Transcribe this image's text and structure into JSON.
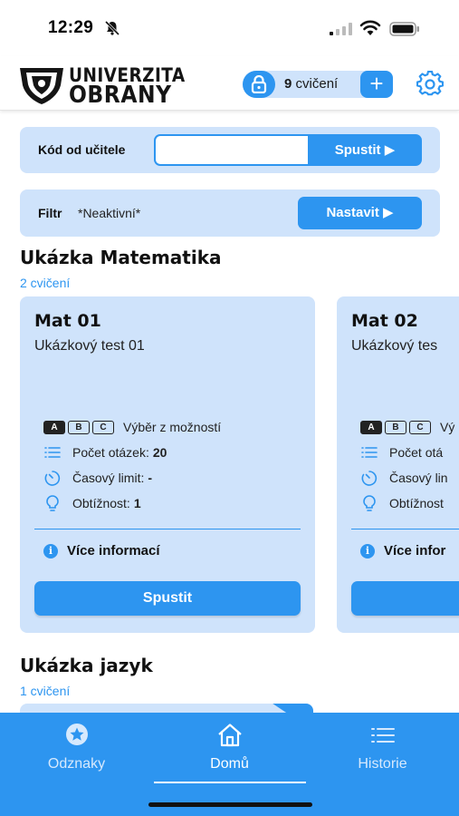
{
  "status_bar": {
    "time": "12:29"
  },
  "header": {
    "logo": {
      "line1": "UNIVERZITA",
      "line2": "OBRANY"
    },
    "credits": {
      "count": "9",
      "unit": "cvičení"
    },
    "add_label": "+"
  },
  "code_panel": {
    "label": "Kód od učitele",
    "input_value": "",
    "input_placeholder": "",
    "submit_label": "Spustit ▶"
  },
  "filter_panel": {
    "label": "Filtr",
    "value": "*Neaktivní*",
    "button_label": "Nastavit ▶"
  },
  "sections": [
    {
      "title": "Ukázka Matematika",
      "count_label": "2 cvičení",
      "cards": [
        {
          "title": "Mat 01",
          "subtitle": "Ukázkový test 01",
          "type_badges": [
            "A",
            "B",
            "C"
          ],
          "type_label": "Výběr z možností",
          "questions_label": "Počet otázek:",
          "questions_value": "20",
          "time_label": "Časový limit:",
          "time_value": "-",
          "difficulty_label": "Obtížnost:",
          "difficulty_value": "1",
          "more_info": "Více informací",
          "start_label": "Spustit"
        },
        {
          "title": "Mat 02",
          "subtitle": "Ukázkový tes",
          "type_badges": [
            "A",
            "B",
            "C"
          ],
          "type_label": "Vý",
          "questions_label": "Počet otá",
          "time_label": "Časový lin",
          "difficulty_label": "Obtížnost",
          "more_info": "Více infor",
          "start_label": "S"
        }
      ]
    },
    {
      "title": "Ukázka jazyk",
      "count_label": "1 cvičení"
    }
  ],
  "tab_bar": {
    "tabs": [
      {
        "label": "Odznaky",
        "icon": "star-badge-icon",
        "active": false
      },
      {
        "label": "Domů",
        "icon": "home-icon",
        "active": true
      },
      {
        "label": "Historie",
        "icon": "list-icon",
        "active": false
      }
    ]
  },
  "colors": {
    "accent": "#2d95f0",
    "panel": "#cfe3fb"
  }
}
